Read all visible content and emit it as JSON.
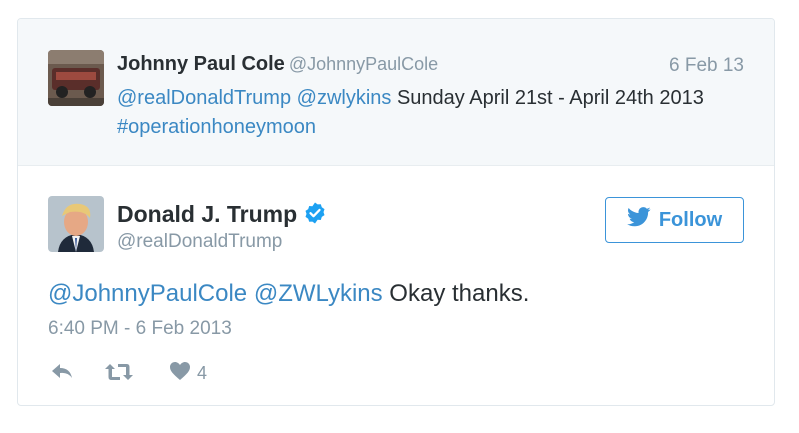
{
  "quoted_tweet": {
    "author_name": "Johnny Paul Cole",
    "author_handle": "@JohnnyPaulCole",
    "date": "6 Feb 13",
    "mention1": "@realDonaldTrump",
    "mention2": "@zwlykins",
    "body": " Sunday April 21st - April 24th 2013",
    "hashtag": "#operationhoneymoon"
  },
  "tweet": {
    "author_name": "Donald J. Trump",
    "author_handle": "@realDonaldTrump",
    "mention1": "@JohnnyPaulCole",
    "mention2": "@ZWLykins",
    "body": " Okay thanks.",
    "timestamp": "6:40 PM - 6 Feb 2013",
    "like_count": "4"
  },
  "follow_button": {
    "label": "Follow"
  },
  "icons": {
    "verified": "verified-badge-icon",
    "bird": "twitter-bird-icon",
    "reply": "reply-icon",
    "retweet": "retweet-icon",
    "like": "heart-icon"
  },
  "colors": {
    "link": "#3b88c3",
    "follow": "#3b94d9",
    "verified": "#1da1f2",
    "secondary": "#8899a6",
    "quoted_bg": "#f5f8fa"
  }
}
